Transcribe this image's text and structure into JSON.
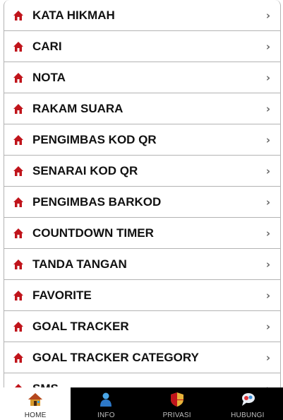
{
  "menu": {
    "items": [
      {
        "label": "KATA HIKMAH",
        "icon": "home-icon"
      },
      {
        "label": "CARI",
        "icon": "home-icon"
      },
      {
        "label": "NOTA",
        "icon": "home-icon"
      },
      {
        "label": "RAKAM SUARA",
        "icon": "home-icon"
      },
      {
        "label": "PENGIMBAS KOD QR",
        "icon": "home-icon"
      },
      {
        "label": "SENARAI KOD QR",
        "icon": "home-icon"
      },
      {
        "label": "PENGIMBAS BARKOD",
        "icon": "home-icon"
      },
      {
        "label": "COUNTDOWN TIMER",
        "icon": "home-icon"
      },
      {
        "label": "TANDA TANGAN",
        "icon": "home-icon"
      },
      {
        "label": "FAVORITE",
        "icon": "home-icon"
      },
      {
        "label": "GOAL TRACKER",
        "icon": "home-icon"
      },
      {
        "label": "GOAL TRACKER CATEGORY",
        "icon": "home-icon"
      },
      {
        "label": "SMS",
        "icon": "home-icon"
      }
    ],
    "chevron": "›"
  },
  "tabbar": {
    "home": "HOME",
    "info": "INFO",
    "privasi": "PRIVASI",
    "hubungi": "HUBUNGI",
    "active": "home"
  },
  "colors": {
    "icon_red": "#c0141b",
    "tabbar_bg": "#000000",
    "divider": "#b3b3b3"
  }
}
